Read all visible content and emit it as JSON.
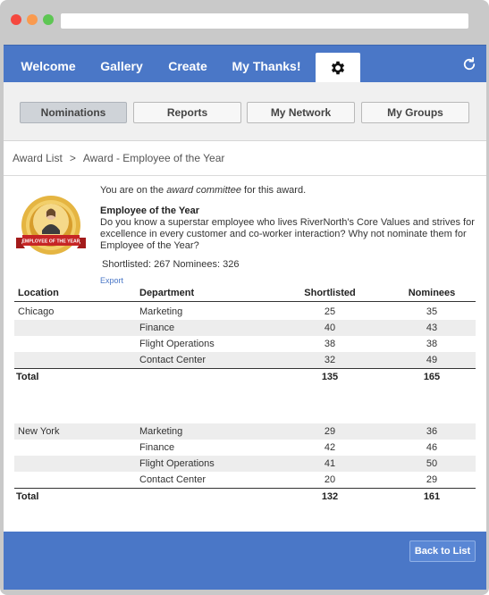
{
  "nav": {
    "tabs": [
      "Welcome",
      "Gallery",
      "Create",
      "My Thanks!"
    ],
    "settings_icon": "gear-icon",
    "refresh_icon": "refresh-icon"
  },
  "subnav": {
    "buttons": [
      "Nominations",
      "Reports",
      "My Network",
      "My Groups"
    ],
    "active": "Nominations"
  },
  "breadcrumb": {
    "root": "Award List",
    "separator": ">",
    "current": "Award - Employee of the Year"
  },
  "award": {
    "committee_prefix": "You are on the ",
    "committee_em": "award committee",
    "committee_suffix": " for this award.",
    "badge_text": "EMPLOYEE OF THE YEAR",
    "title": "Employee of the Year",
    "description": "Do you know a superstar employee who lives RiverNorth's Core Values and strives for excellence in every customer and co-worker interaction? Why not nominate them for Employee of the Year?",
    "stats": "Shortlisted: 267 Nominees: 326",
    "export": "Export"
  },
  "table": {
    "headers": [
      "Location",
      "Department",
      "Shortlisted",
      "Nominees"
    ],
    "groups": [
      {
        "location": "Chicago",
        "rows": [
          {
            "department": "Marketing",
            "shortlisted": "25",
            "nominees": "35"
          },
          {
            "department": "Finance",
            "shortlisted": "40",
            "nominees": "43"
          },
          {
            "department": "Flight Operations",
            "shortlisted": "38",
            "nominees": "38"
          },
          {
            "department": "Contact Center",
            "shortlisted": "32",
            "nominees": "49"
          }
        ],
        "total_label": "Total",
        "total_shortlisted": "135",
        "total_nominees": "165"
      },
      {
        "location": "New York",
        "rows": [
          {
            "department": "Marketing",
            "shortlisted": "29",
            "nominees": "36"
          },
          {
            "department": "Finance",
            "shortlisted": "42",
            "nominees": "46"
          },
          {
            "department": "Flight Operations",
            "shortlisted": "41",
            "nominees": "50"
          },
          {
            "department": "Contact Center",
            "shortlisted": "20",
            "nominees": "29"
          }
        ],
        "total_label": "Total",
        "total_shortlisted": "132",
        "total_nominees": "161"
      }
    ]
  },
  "footer": {
    "back_label": "Back to List"
  },
  "colors": {
    "brand_blue": "#4a77c7",
    "dot_red": "#f5483f",
    "dot_orange": "#f99a4f",
    "dot_green": "#5dc653"
  }
}
